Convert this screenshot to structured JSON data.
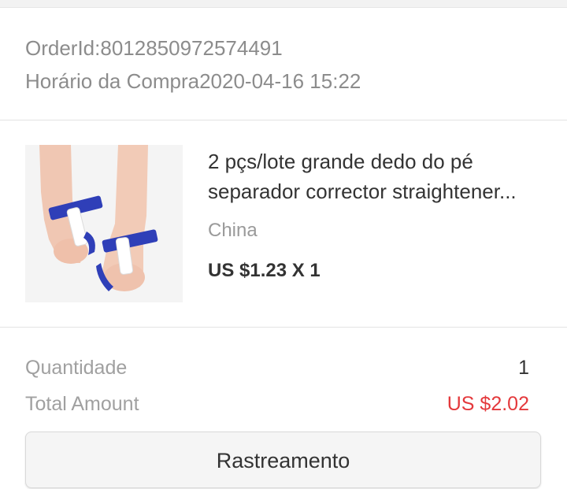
{
  "order": {
    "id_text": "OrderId:8012850972574491",
    "purchase_time_text": "Horário da Compra2020-04-16 15:22"
  },
  "product": {
    "title_line1": "2 pçs/lote grande dedo do pé",
    "title_line2": "separador corrector straightener...",
    "origin": "China",
    "price_qty": "US $1.23 X 1"
  },
  "summary": {
    "quantity_label": "Quantidade",
    "quantity_value": "1",
    "total_label": "Total Amount",
    "total_value": "US $2.02"
  },
  "actions": {
    "tracking_label": "Rastreamento"
  },
  "colors": {
    "accent_price": "#e4393c",
    "muted_text": "#8c8c8c",
    "primary_text": "#333333"
  }
}
